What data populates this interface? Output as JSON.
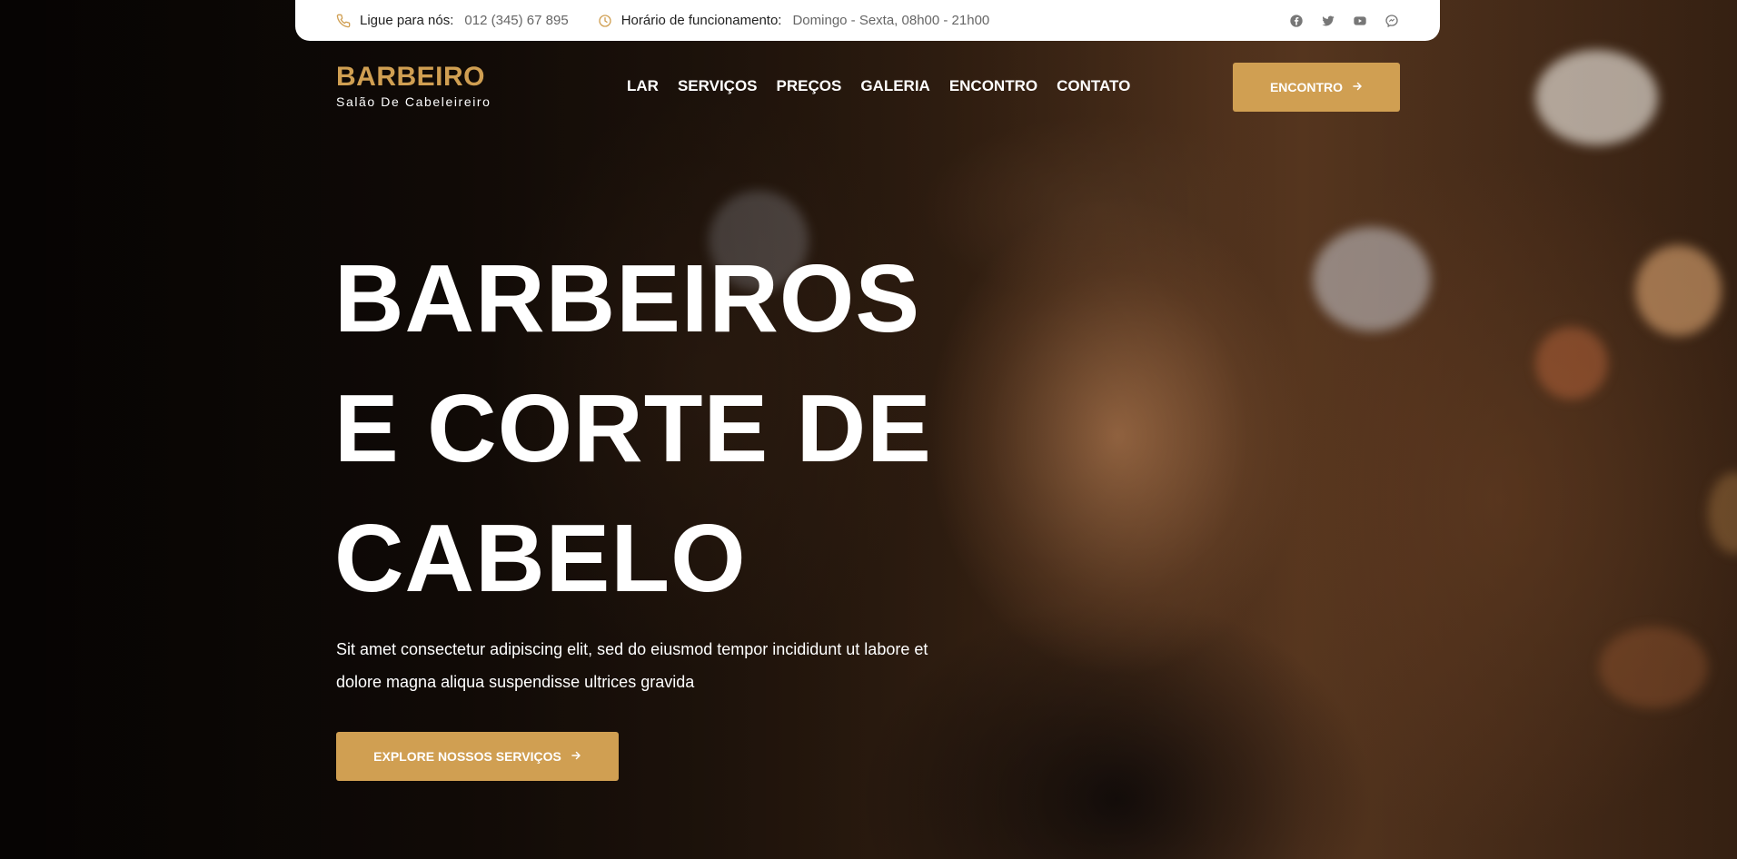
{
  "topbar": {
    "phone_label": "Ligue para nós:",
    "phone_value": "012 (345) 67 895",
    "hours_label": "Horário de funcionamento:",
    "hours_value": "Domingo - Sexta, 08h00 - 21h00",
    "social_icons": [
      "facebook-icon",
      "twitter-icon",
      "youtube-icon",
      "messenger-icon"
    ]
  },
  "brand": {
    "title": "BARBEIRO",
    "subtitle": "Salão De Cabeleireiro"
  },
  "nav": {
    "items": [
      {
        "label": "LAR"
      },
      {
        "label": "SERVIÇOS"
      },
      {
        "label": "PREÇOS"
      },
      {
        "label": "GALERIA"
      },
      {
        "label": "ENCONTRO"
      },
      {
        "label": "CONTATO"
      }
    ]
  },
  "header_cta": {
    "label": "ENCONTRO",
    "icon": "arrow-right-icon"
  },
  "hero": {
    "headline": [
      "BARBEIROS",
      "E CORTE DE",
      "CABELO"
    ],
    "text_line1": "Sit amet consectetur adipiscing elit, sed do eiusmod tempor incididunt ut labore et",
    "text_line2": "dolore magna aliqua suspendisse ultrices gravida",
    "cta_label": "EXPLORE NOSSOS SERVIÇOS",
    "cta_icon": "arrow-right-icon"
  },
  "colors": {
    "accent": "#d09f52",
    "topbar_bg": "#ffffff",
    "text_light": "#ffffff"
  }
}
